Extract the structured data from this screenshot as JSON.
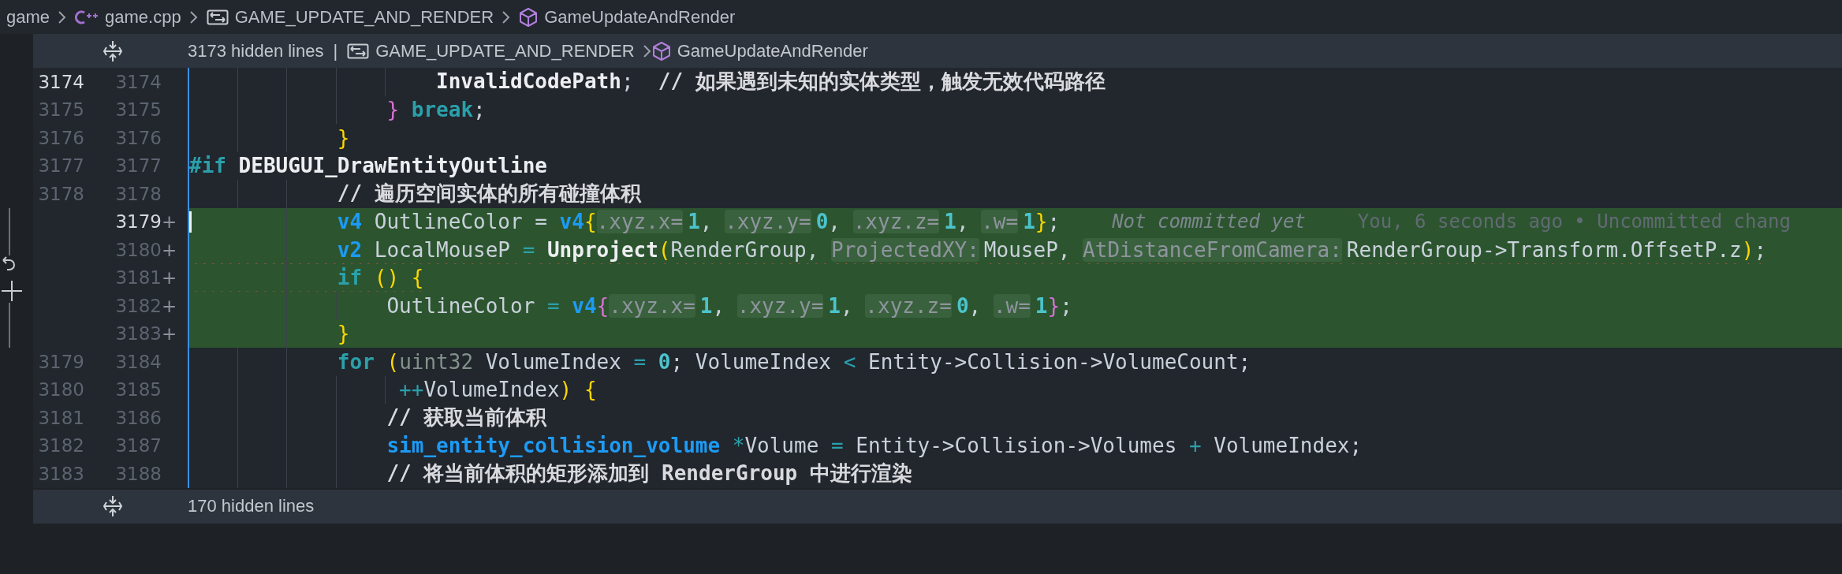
{
  "breadcrumb": [
    {
      "label": "game",
      "kind": "folder"
    },
    {
      "label": "game.cpp",
      "kind": "cpp"
    },
    {
      "label": "GAME_UPDATE_AND_RENDER",
      "kind": "macro"
    },
    {
      "label": "GameUpdateAndRender",
      "kind": "function"
    }
  ],
  "hidden_top": {
    "count_label": "3173 hidden lines",
    "separator": "|",
    "path": [
      {
        "label": "GAME_UPDATE_AND_RENDER",
        "kind": "macro"
      },
      {
        "label": "GameUpdateAndRender",
        "kind": "function"
      }
    ]
  },
  "lines": [
    {
      "old": "3174",
      "new": "3174",
      "old_active": true,
      "tokens": [
        {
          "t": "                    InvalidCodePath",
          "kind": "macro"
        },
        {
          "t": ";  ",
          "kind": "plain"
        },
        {
          "t": "// 如果遇到未知的实体类型，触发无效代码路径",
          "kind": "comment"
        }
      ]
    },
    {
      "old": "3175",
      "new": "3175",
      "tokens": [
        {
          "t": "                }",
          "kind": "bracket_nested"
        },
        {
          "t": " break",
          "kind": "keyword"
        },
        {
          "t": ";",
          "kind": "plain"
        }
      ]
    },
    {
      "old": "3176",
      "new": "3176",
      "tokens": [
        {
          "t": "            }",
          "kind": "bracket"
        }
      ]
    },
    {
      "old": "3177",
      "new": "3177",
      "tokens": [
        {
          "t": "#if",
          "kind": "keyword"
        },
        {
          "t": " DEBUGUI_DrawEntityOutline",
          "kind": "macro"
        }
      ]
    },
    {
      "old": "3178",
      "new": "3178",
      "tokens": [
        {
          "t": "            // 遍历空间实体的所有碰撞体积",
          "kind": "comment"
        }
      ]
    },
    {
      "new": "3179",
      "marker": "+",
      "added": true,
      "new_active": true,
      "tokens": [
        {
          "t": "            v4",
          "kind": "type"
        },
        {
          "t": " OutlineColor = ",
          "kind": "plain"
        },
        {
          "t": "v4",
          "kind": "type"
        },
        {
          "t": "{",
          "kind": "bracket"
        },
        {
          "t": ".xyz.x=",
          "kind": "hint"
        },
        {
          "t": "1",
          "kind": "number"
        },
        {
          "t": ", ",
          "kind": "plain"
        },
        {
          "t": ".xyz.y=",
          "kind": "hint"
        },
        {
          "t": "0",
          "kind": "number"
        },
        {
          "t": ", ",
          "kind": "plain"
        },
        {
          "t": ".xyz.z=",
          "kind": "hint"
        },
        {
          "t": "1",
          "kind": "number"
        },
        {
          "t": ", ",
          "kind": "plain"
        },
        {
          "t": ".w=",
          "kind": "hint"
        },
        {
          "t": "1",
          "kind": "number"
        },
        {
          "t": "}",
          "kind": "bracket"
        },
        {
          "t": ";",
          "kind": "plain"
        }
      ],
      "blame": [
        "Not committed yet",
        "You, 6 seconds ago • Uncommitted chang"
      ]
    },
    {
      "new": "3180",
      "marker": "+",
      "added": true,
      "error": true,
      "tokens": [
        {
          "t": "            v2",
          "kind": "type"
        },
        {
          "t": " LocalMouseP ",
          "kind": "plain"
        },
        {
          "t": "=",
          "kind": "operator"
        },
        {
          "t": " Unproject",
          "kind": "macro"
        },
        {
          "t": "(",
          "kind": "bracket"
        },
        {
          "t": "RenderGroup, ",
          "kind": "plain"
        },
        {
          "t": "ProjectedXY:",
          "kind": "hint"
        },
        {
          "t": "MouseP, ",
          "kind": "plain"
        },
        {
          "t": "AtDistanceFromCamera:",
          "kind": "hint"
        },
        {
          "t": "RenderGroup->Transform.OffsetP.z",
          "kind": "plain"
        },
        {
          "t": ")",
          "kind": "bracket"
        },
        {
          "t": ";",
          "kind": "plain"
        }
      ]
    },
    {
      "new": "3181",
      "marker": "+",
      "added": true,
      "error": true,
      "tokens": [
        {
          "t": "            if",
          "kind": "keyword"
        },
        {
          "t": " () {",
          "kind": "bracket"
        }
      ]
    },
    {
      "new": "3182",
      "marker": "+",
      "added": true,
      "tokens": [
        {
          "t": "                OutlineColor ",
          "kind": "plain"
        },
        {
          "t": "=",
          "kind": "operator"
        },
        {
          "t": " v4",
          "kind": "type"
        },
        {
          "t": "{",
          "kind": "bracket_nested"
        },
        {
          "t": ".xyz.x=",
          "kind": "hint"
        },
        {
          "t": "1",
          "kind": "number"
        },
        {
          "t": ", ",
          "kind": "plain"
        },
        {
          "t": ".xyz.y=",
          "kind": "hint"
        },
        {
          "t": "1",
          "kind": "number"
        },
        {
          "t": ", ",
          "kind": "plain"
        },
        {
          "t": ".xyz.z=",
          "kind": "hint"
        },
        {
          "t": "0",
          "kind": "number"
        },
        {
          "t": ", ",
          "kind": "plain"
        },
        {
          "t": ".w=",
          "kind": "hint"
        },
        {
          "t": "1",
          "kind": "number"
        },
        {
          "t": "}",
          "kind": "bracket_nested"
        },
        {
          "t": ";",
          "kind": "plain"
        }
      ]
    },
    {
      "new": "3183",
      "marker": "+",
      "added": true,
      "tokens": [
        {
          "t": "            }",
          "kind": "bracket"
        }
      ]
    },
    {
      "old": "3179",
      "new": "3184",
      "tokens": [
        {
          "t": "            for",
          "kind": "keyword"
        },
        {
          "t": " (",
          "kind": "bracket"
        },
        {
          "t": "uint32",
          "kind": "dim"
        },
        {
          "t": " VolumeIndex ",
          "kind": "plain"
        },
        {
          "t": "=",
          "kind": "operator"
        },
        {
          "t": " 0",
          "kind": "number"
        },
        {
          "t": "; VolumeIndex ",
          "kind": "plain"
        },
        {
          "t": "<",
          "kind": "operator"
        },
        {
          "t": " Entity->Collision->VolumeCount;",
          "kind": "plain"
        }
      ]
    },
    {
      "old": "3180",
      "new": "3185",
      "tokens": [
        {
          "t": "                 ++",
          "kind": "operator"
        },
        {
          "t": "VolumeIndex",
          "kind": "plain"
        },
        {
          "t": ") {",
          "kind": "bracket"
        }
      ]
    },
    {
      "old": "3181",
      "new": "3186",
      "tokens": [
        {
          "t": "                // 获取当前体积",
          "kind": "comment"
        }
      ]
    },
    {
      "old": "3182",
      "new": "3187",
      "tokens": [
        {
          "t": "                sim_entity_collision_volume",
          "kind": "type"
        },
        {
          "t": " *",
          "kind": "operator"
        },
        {
          "t": "Volume ",
          "kind": "plain"
        },
        {
          "t": "=",
          "kind": "operator"
        },
        {
          "t": " Entity->Collision->Volumes ",
          "kind": "plain"
        },
        {
          "t": "+",
          "kind": "operator"
        },
        {
          "t": " VolumeIndex;",
          "kind": "plain"
        }
      ]
    },
    {
      "old": "3183",
      "new": "3188",
      "tokens": [
        {
          "t": "                // 将当前体积的矩形添加到 RenderGroup 中进行渲染",
          "kind": "comment"
        }
      ]
    }
  ],
  "hidden_bottom": {
    "count_label": "170 hidden lines"
  }
}
